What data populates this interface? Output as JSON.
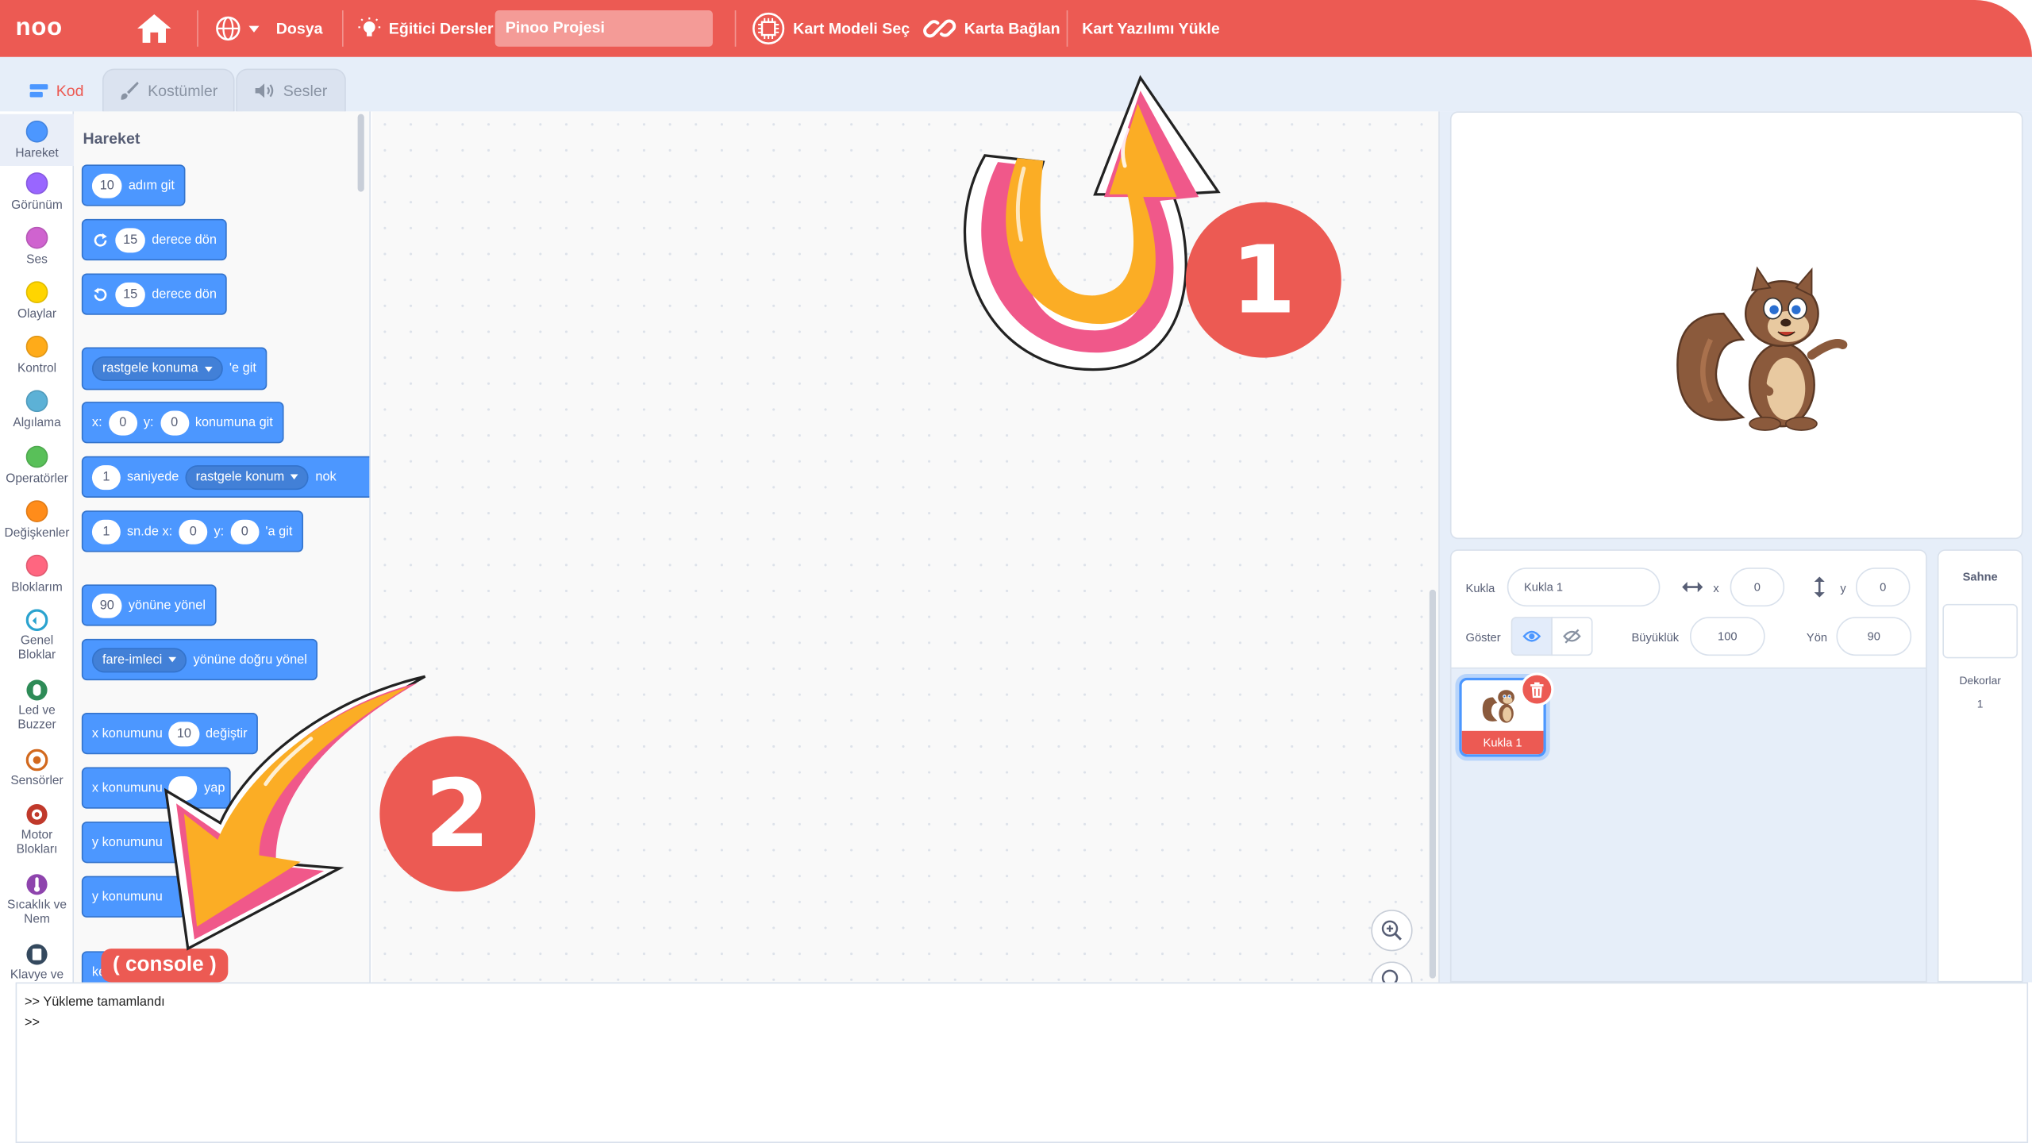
{
  "menu": {
    "logo": "noo",
    "file": "Dosya",
    "tutorials": "Eğitici Dersler",
    "project_name": "Pinoo Projesi",
    "select_board": "Kart Modeli Seç",
    "connect_board": "Karta Bağlan",
    "upload_firmware": "Kart Yazılımı Yükle"
  },
  "tabs": [
    {
      "label": "Kod",
      "icon": "code-icon",
      "active": true
    },
    {
      "label": "Kostümler",
      "icon": "brush-icon",
      "active": false
    },
    {
      "label": "Sesler",
      "icon": "speaker-icon",
      "active": false
    }
  ],
  "categories": [
    {
      "label": "Hareket",
      "color": "#4c97ff"
    },
    {
      "label": "Görünüm",
      "color": "#9966ff"
    },
    {
      "label": "Ses",
      "color": "#cf63cf"
    },
    {
      "label": "Olaylar",
      "color": "#ffd500"
    },
    {
      "label": "Kontrol",
      "color": "#ffab19"
    },
    {
      "label": "Algılama",
      "color": "#5cb1d6"
    },
    {
      "label": "Operatörler",
      "color": "#59c059"
    },
    {
      "label": "Değişkenler",
      "color": "#ff8c1a"
    },
    {
      "label": "Bloklarım",
      "color": "#ff6680"
    },
    {
      "label": "Genel Bloklar",
      "color": "#2ba3cf"
    },
    {
      "label": "Led ve Buzzer",
      "color": "#2e8b57"
    },
    {
      "label": "Sensörler",
      "color": "#d2691e"
    },
    {
      "label": "Motor Blokları",
      "color": "#c0392b"
    },
    {
      "label": "Sıcaklık ve Nem",
      "color": "#8e44ad"
    },
    {
      "label": "Klavye ve",
      "color": "#34495e"
    }
  ],
  "palette": {
    "title": "Hareket",
    "blocks": {
      "move": {
        "value": "10",
        "text": "adım git"
      },
      "turn_right": {
        "value": "15",
        "text": "derece dön"
      },
      "turn_left": {
        "value": "15",
        "text": "derece dön"
      },
      "goto": {
        "menu": "rastgele konuma",
        "text": "'e git"
      },
      "goto_xy": {
        "x_label": "x:",
        "x": "0",
        "y_label": "y:",
        "y": "0",
        "text": "konumuna git"
      },
      "glide": {
        "value": "1",
        "text1": "saniyede",
        "menu": "rastgele konum",
        "text2": "nok"
      },
      "glide_xy": {
        "value": "1",
        "text1": "sn.de x:",
        "x": "0",
        "y_label": "y:",
        "y": "0",
        "text2": "'a git"
      },
      "point_dir": {
        "value": "90",
        "text": "yönüne yönel"
      },
      "point_towards": {
        "menu": "fare-imleci",
        "text": "yönüne doğru yönel"
      },
      "change_x": {
        "text1": "x konumunu",
        "value": "10",
        "text2": "değiştir"
      },
      "set_x": {
        "text1": "x konumunu",
        "text2": "yap"
      },
      "change_y": {
        "text1": "y konumunu"
      },
      "set_y": {
        "text1": "y konumunu"
      },
      "edge": {
        "text1": "ke"
      }
    }
  },
  "sprite": {
    "sprite_label": "Kukla",
    "sprite_name": "Kukla 1",
    "x_label": "x",
    "x": "0",
    "y_label": "y",
    "y": "0",
    "show_label": "Göster",
    "size_label": "Büyüklük",
    "size": "100",
    "direction_label": "Yön",
    "direction": "90",
    "tile_name": "Kukla 1"
  },
  "stage_side": {
    "title": "Sahne",
    "backdrops_label": "Dekorlar",
    "backdrops_count": "1"
  },
  "console": {
    "tag": "( console )",
    "line1": ">> Yükleme tamamlandı",
    "line2": ">>"
  },
  "annotations": {
    "badge1": "1",
    "badge2": "2"
  },
  "colors": {
    "brand": "#ec5a53",
    "motion": "#4c97ff",
    "arrow_orange": "#fbad25",
    "arrow_pink": "#f0588a"
  }
}
